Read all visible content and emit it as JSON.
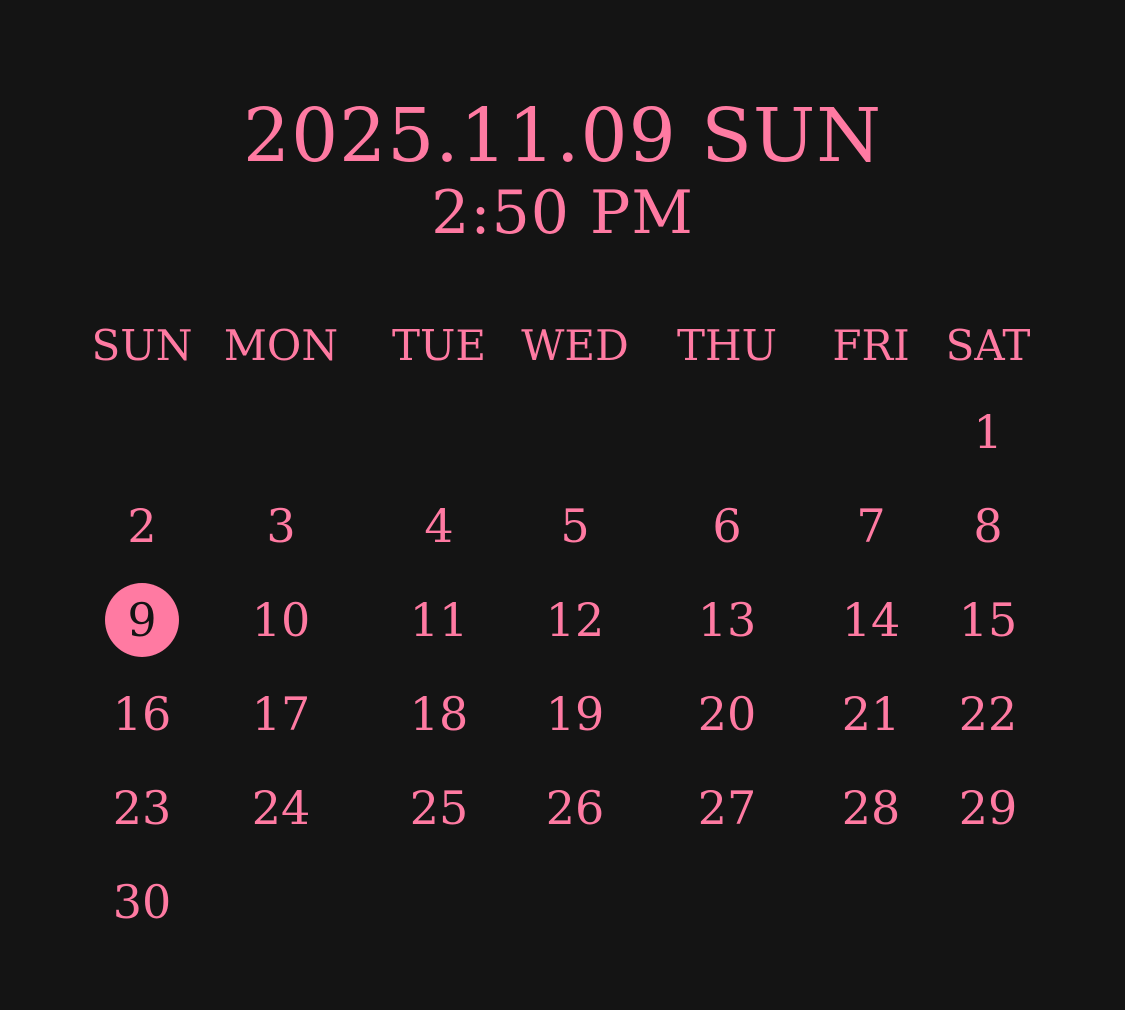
{
  "header": {
    "date": "2025.11.09 SUN",
    "time": "2:50 PM"
  },
  "weekdays": [
    "SUN",
    "MON",
    "TUE",
    "WED",
    "THU",
    "FRI",
    "SAT"
  ],
  "days": [
    "1",
    "2",
    "3",
    "4",
    "5",
    "6",
    "7",
    "8",
    "9",
    "10",
    "11",
    "12",
    "13",
    "14",
    "15",
    "16",
    "17",
    "18",
    "19",
    "20",
    "21",
    "22",
    "23",
    "24",
    "25",
    "26",
    "27",
    "28",
    "29",
    "30"
  ],
  "today": "9",
  "colors": {
    "background": "#141414",
    "accent": "#ff7aa2",
    "today_text": "#141414"
  }
}
